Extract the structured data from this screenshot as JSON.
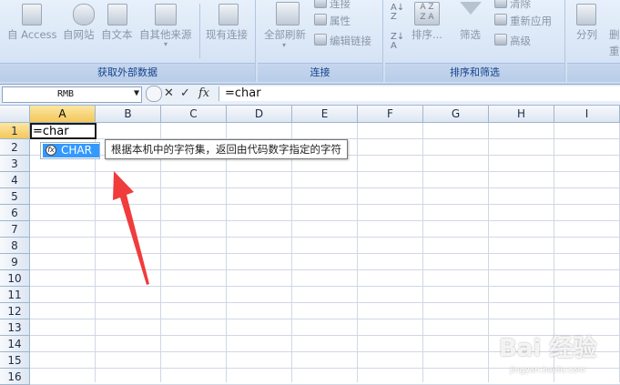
{
  "ribbon": {
    "groups": [
      {
        "label": "获取外部数据",
        "buttons": [
          "自 Access",
          "自网站",
          "自文本",
          "自其他来源",
          "现有连接"
        ]
      },
      {
        "label": "连接",
        "main_button": "全部刷新",
        "small_buttons": [
          "连接",
          "属性",
          "编辑链接"
        ]
      },
      {
        "label": "排序和筛选",
        "sort_button": "排序...",
        "filter_button": "筛选",
        "small_buttons": [
          "清除",
          "重新应用",
          "高级"
        ]
      },
      {
        "label": "",
        "buttons": [
          "分列",
          "删",
          "重"
        ]
      }
    ]
  },
  "formula_bar": {
    "name_box": "RMB",
    "cancel_symbol": "✕",
    "enter_symbol": "✓",
    "fx_label": "fx",
    "content": "=char"
  },
  "grid": {
    "columns": [
      "A",
      "B",
      "C",
      "D",
      "E",
      "F",
      "G",
      "H",
      "I"
    ],
    "rows": [
      "1",
      "2",
      "3",
      "4",
      "5",
      "6",
      "7",
      "8",
      "9",
      "10",
      "11",
      "12",
      "13",
      "14",
      "15",
      "16"
    ],
    "active_cell": {
      "ref": "A1",
      "value": "=char"
    }
  },
  "autocomplete": {
    "icon_text": "fx",
    "item": "CHAR",
    "tooltip": "根据本机中的字符集，返回由代码数字指定的字符"
  },
  "annotation": {
    "color": "#f03c3c"
  },
  "watermark": {
    "text": "Bai 经验",
    "sub": "jingyan.baidu.com"
  },
  "colors": {
    "accent": "#3399ff",
    "selected_header": "#f4c75b",
    "ribbon_text": "#15428b"
  }
}
